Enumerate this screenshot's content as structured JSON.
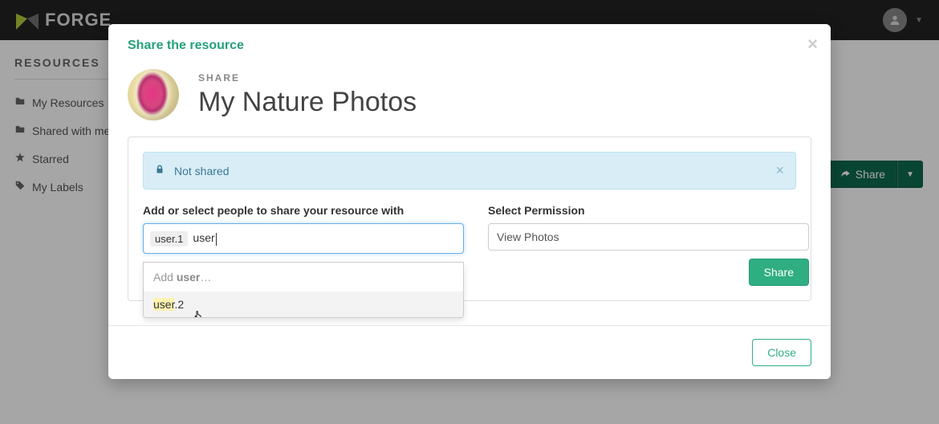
{
  "brand": "FORGE",
  "sidebar": {
    "heading": "RESOURCES",
    "items": [
      {
        "label": "My Resources",
        "icon": "folder-icon"
      },
      {
        "label": "Shared with me",
        "icon": "folder-icon"
      },
      {
        "label": "Starred",
        "icon": "star-icon"
      },
      {
        "label": "My Labels",
        "icon": "tag-icon"
      }
    ]
  },
  "page_actions": {
    "share_label": "Share"
  },
  "modal": {
    "title": "Share the resource",
    "kicker": "SHARE",
    "resource_name": "My Nature Photos",
    "alert": {
      "text": "Not shared",
      "icon": "lock-icon"
    },
    "people_label": "Add or select people to share your resource with",
    "permission_label": "Select Permission",
    "permission_value": "View Photos",
    "tokens": [
      "user.1"
    ],
    "search_value": "user",
    "dropdown": {
      "hint_prefix": "Add ",
      "hint_query": "user",
      "hint_suffix": "…",
      "options": [
        {
          "match": "user",
          "rest": ".2"
        }
      ]
    },
    "share_button": "Share",
    "close_button": "Close"
  }
}
